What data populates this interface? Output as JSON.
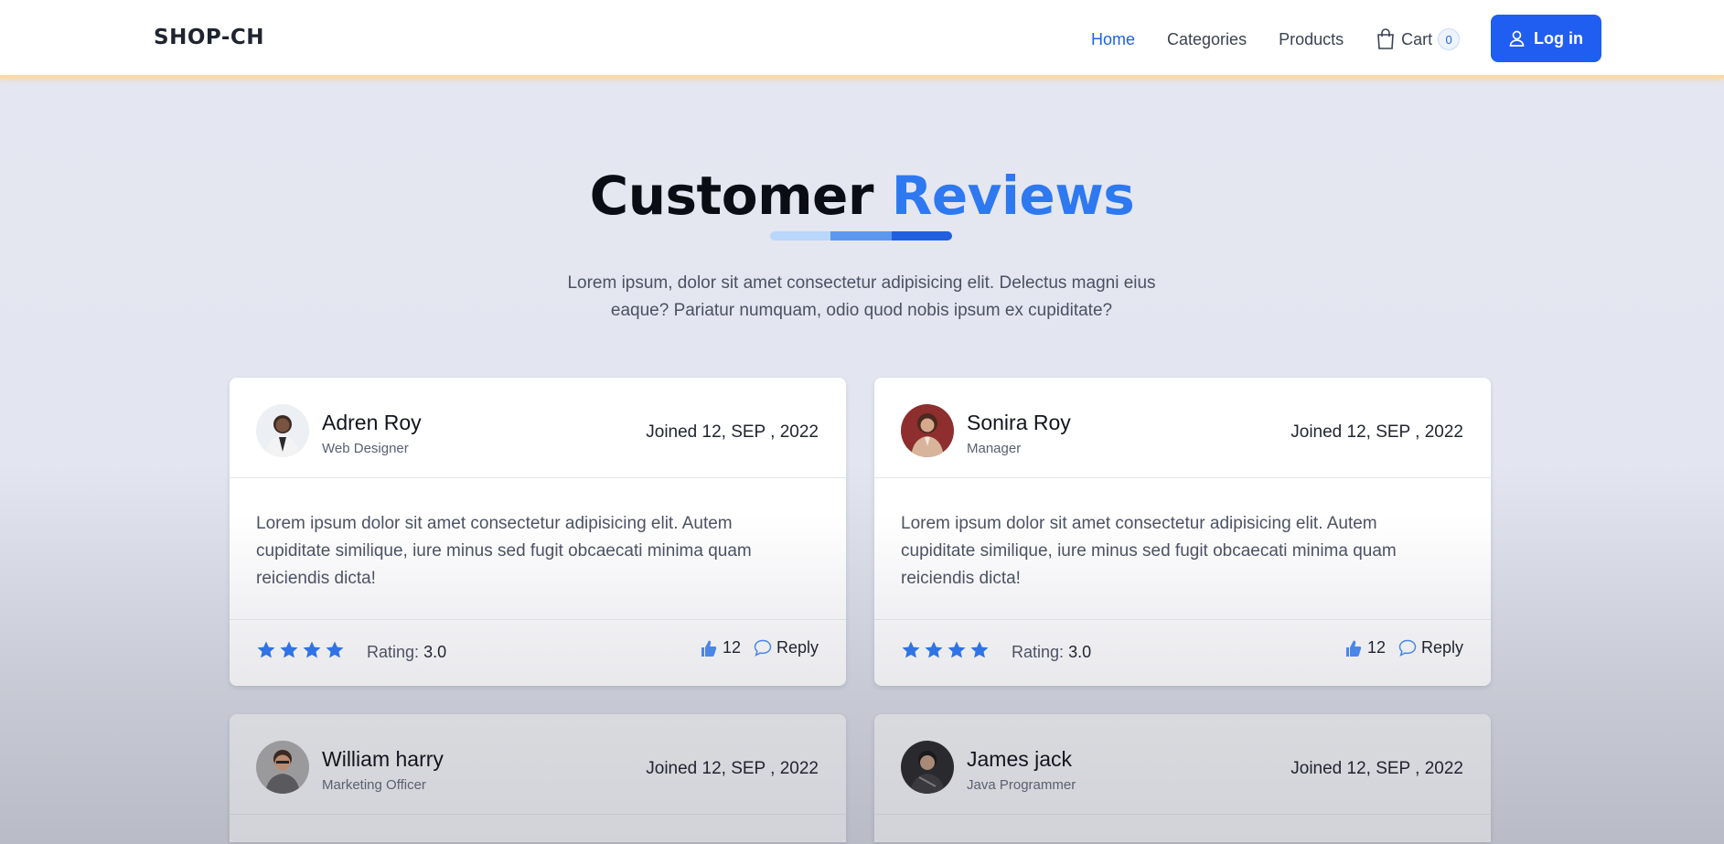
{
  "nav": {
    "brand": "SHOP-CH",
    "links": [
      "Home",
      "Categories",
      "Products"
    ],
    "cart_label": "Cart",
    "cart_count": "0",
    "login_label": "Log in"
  },
  "header": {
    "title_main": "Customer",
    "title_accent": "Reviews",
    "subtitle": "Lorem ipsum, dolor sit amet consectetur adipisicing elit. Delectus magni eius eaque? Pariatur numquam, odio quod nobis ipsum ex cupiditate?"
  },
  "reviews": [
    {
      "name": "Adren Roy",
      "role": "Web Designer",
      "joined": "Joined 12, SEP , 2022",
      "text": "Lorem ipsum dolor sit amet consectetur adipisicing elit. Autem cupiditate similique, iure minus sed fugit obcaecati minima quam reiciendis dicta!",
      "stars": 4,
      "rating_label": "Rating:",
      "rating_value": "3.0",
      "likes": "12",
      "reply_label": "Reply"
    },
    {
      "name": "Sonira Roy",
      "role": "Manager",
      "joined": "Joined 12, SEP , 2022",
      "text": "Lorem ipsum dolor sit amet consectetur adipisicing elit. Autem cupiditate similique, iure minus sed fugit obcaecati minima quam reiciendis dicta!",
      "stars": 4,
      "rating_label": "Rating:",
      "rating_value": "3.0",
      "likes": "12",
      "reply_label": "Reply"
    },
    {
      "name": "William harry",
      "role": "Marketing Officer",
      "joined": "Joined 12, SEP , 2022"
    },
    {
      "name": "James jack",
      "role": "Java Programmer",
      "joined": "Joined 12, SEP , 2022"
    }
  ],
  "colors": {
    "accent": "#2e78f0",
    "button": "#1f5ef0",
    "star": "#2f73e6",
    "underline": [
      "#b9d6fb",
      "#5b98ee",
      "#1f5fe0"
    ]
  }
}
